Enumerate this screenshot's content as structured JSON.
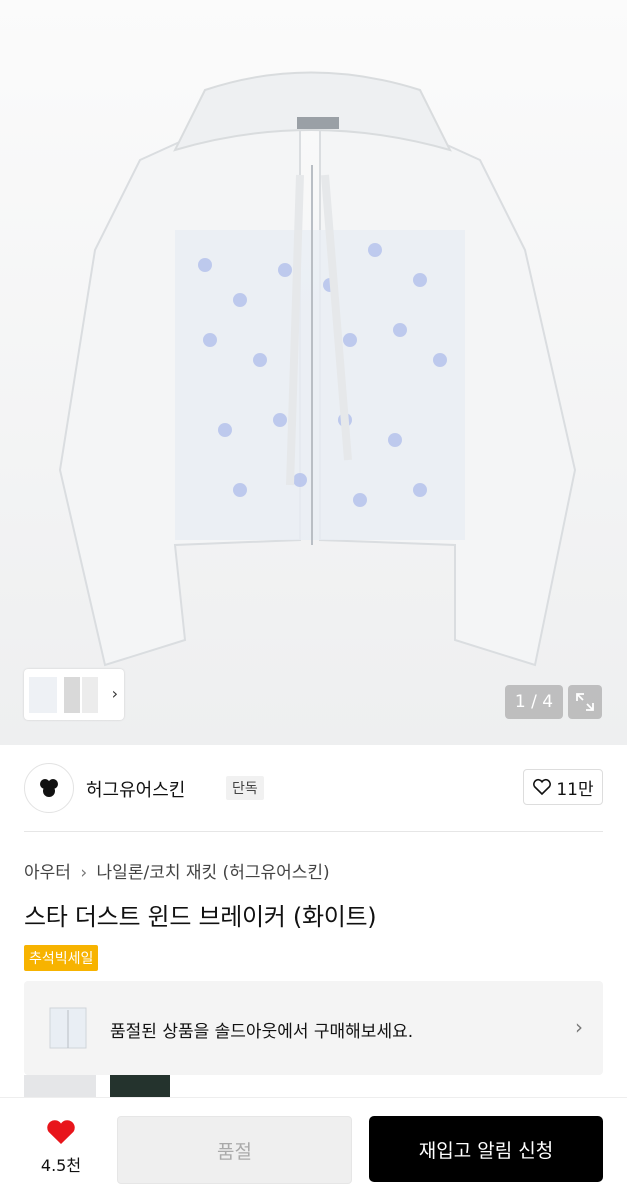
{
  "gallery": {
    "counter": "1 / 4",
    "thumbnail_more_icon": "chevron-right-icon",
    "expand_icon": "expand-icon"
  },
  "brand": {
    "name": "허그유어스킨",
    "badge": "단독",
    "likes": "11만",
    "like_icon": "heart-outline-icon"
  },
  "breadcrumb": {
    "category": "아우터",
    "subcategory": "나일론/코치 재킷 (허그유어스킨)",
    "separator_icon": "chevron-right-icon"
  },
  "product": {
    "title": "스타 더스트 윈드 브레이커 (화이트)",
    "promo_tag": "추석빅세일"
  },
  "soldout_banner": {
    "text": "품절된 상품을 솔드아웃에서 구매해보세요."
  },
  "bottom_bar": {
    "wish_count": "4.5천",
    "soldout_label": "품절",
    "restock_label": "재입고 알림 신청"
  },
  "colors": {
    "promo": "#f7b300",
    "heart": "#e8151b",
    "primary_button": "#000000"
  }
}
